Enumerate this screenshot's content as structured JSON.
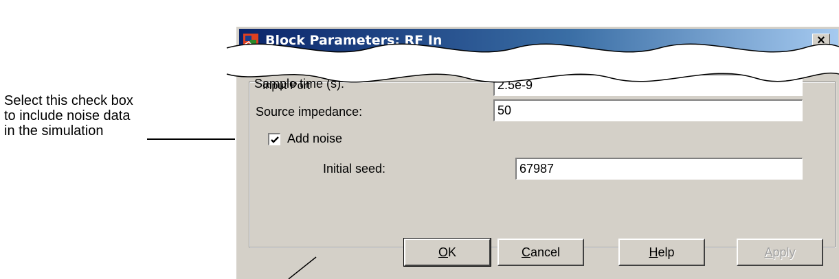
{
  "annotation": {
    "lines": [
      "Select this check box",
      "to include noise data",
      "in the simulation"
    ]
  },
  "dialog": {
    "title": "Block Parameters: RF In",
    "close_glyph": "×",
    "group_label": "Input Port",
    "fields": {
      "sample_time_label": "Sample time (s):",
      "sample_time_value": "2.5e-9",
      "source_impedance_label": "Source impedance:",
      "source_impedance_value": "50",
      "add_noise_label": "Add noise",
      "add_noise_checked": true,
      "initial_seed_label": "Initial seed:",
      "initial_seed_value": "67987"
    },
    "buttons": {
      "ok": {
        "mnemonic": "O",
        "rest": "K"
      },
      "cancel": {
        "mnemonic": "C",
        "rest": "ancel"
      },
      "help": {
        "mnemonic": "H",
        "rest": "elp"
      },
      "apply": {
        "mnemonic": "A",
        "rest": "pply",
        "enabled": false
      }
    }
  },
  "colors": {
    "dialog_face": "#d4d0c8",
    "titlebar_start": "#0a246a",
    "titlebar_end": "#a6caf0"
  },
  "icons": [
    "simulink-block-icon",
    "close-icon",
    "checkmark-icon",
    "arrow-head-icon"
  ]
}
